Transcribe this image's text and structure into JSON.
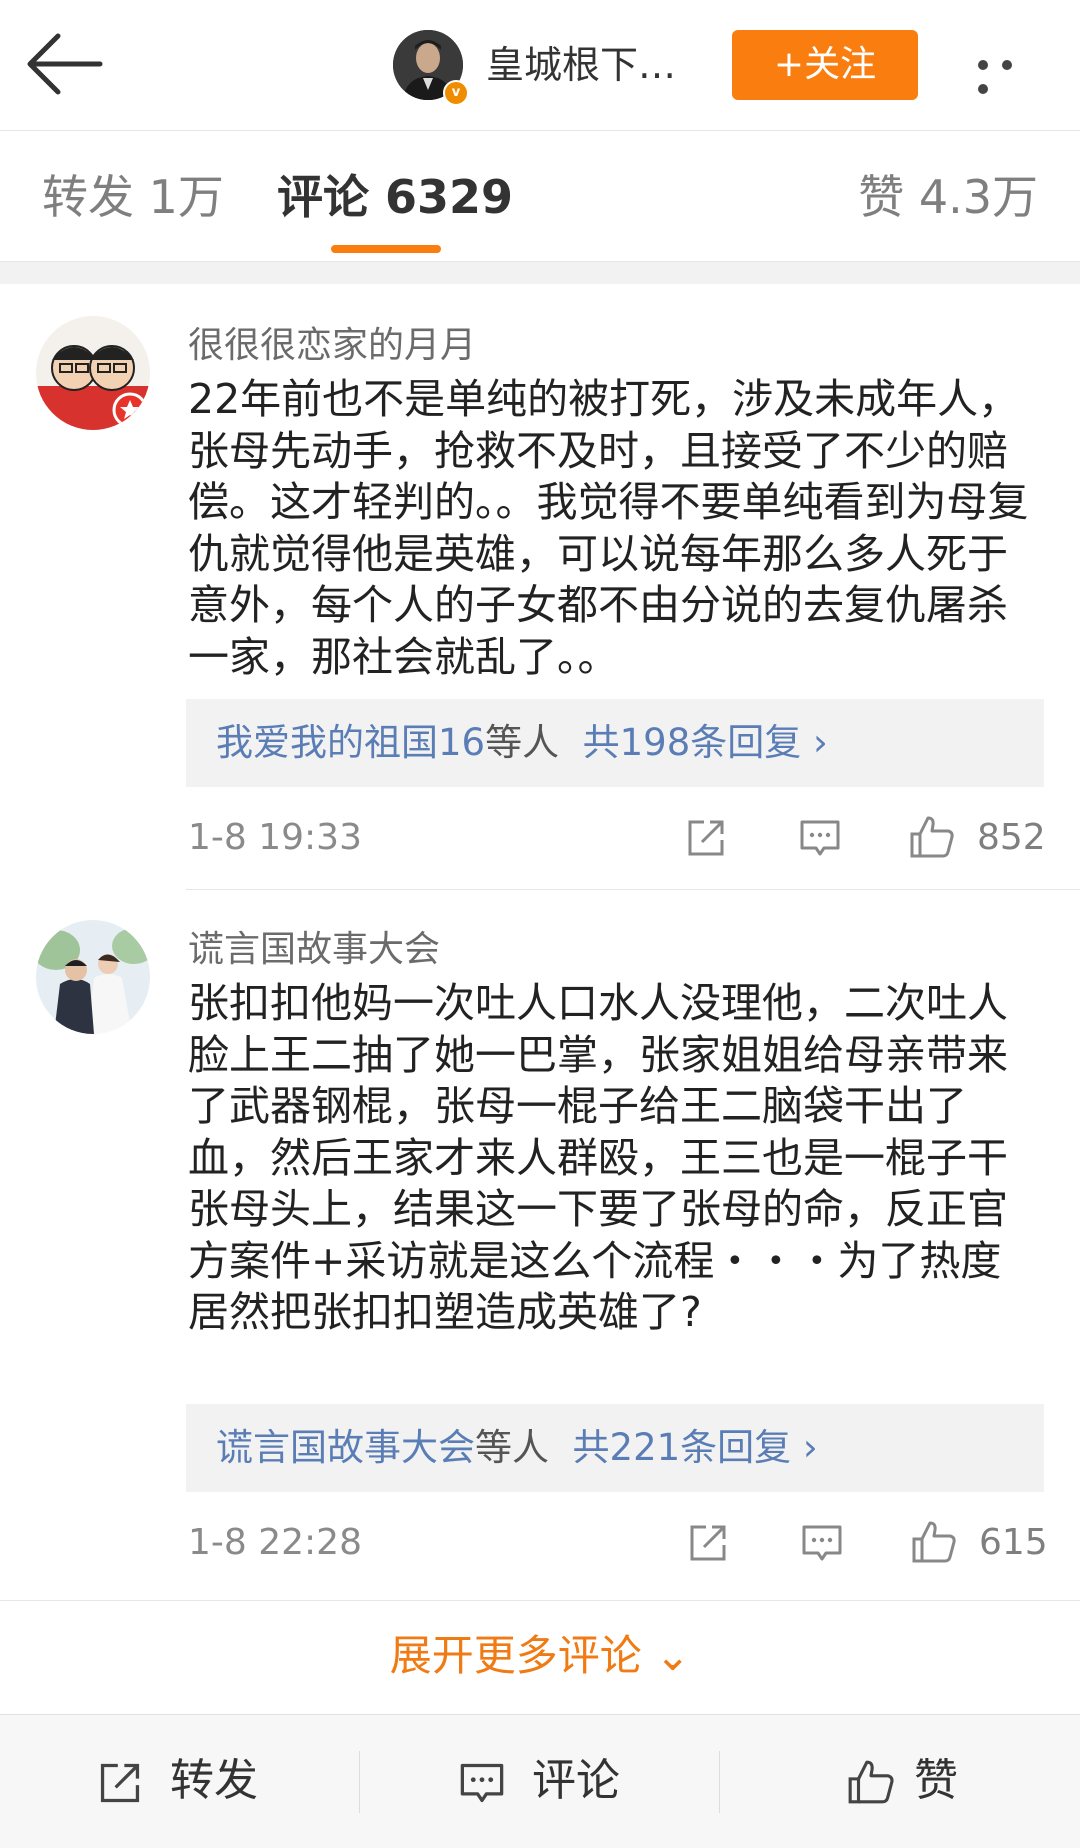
{
  "header": {
    "author_name": "皇城根下…",
    "follow_label": "+关注"
  },
  "tabs": {
    "repost": "转发 1万",
    "comment": "评论 6329",
    "like": "赞 4.3万"
  },
  "comments": [
    {
      "user": "很很很恋家的月月",
      "text": "22年前也不是单纯的被打死，涉及未成年人，张母先动手，抢救不及时，且接受了不少的赔偿。这才轻判的。。我觉得不要单纯看到为母复仇就觉得他是英雄，可以说每年那么多人死于意外，每个人的子女都不由分说的去复仇屠杀一家，那社会就乱了。。",
      "reply_users": "我爱我的祖国16",
      "reply_suffix": "等人",
      "reply_count": "共198条回复 ›",
      "time": "1-8 19:33",
      "likes": "852"
    },
    {
      "user": "谎言国故事大会",
      "text": "张扣扣他妈一次吐人口水人没理他，二次吐人脸上王二抽了她一巴掌，张家姐姐给母亲带来了武器钢棍，张母一棍子给王二脑袋干出了血，然后王家才来人群殴，王三也是一棍子干张母头上，结果这一下要了张母的命，反正官方案件+采访就是这么个流程・・・为了热度居然把张扣扣塑造成英雄了?",
      "reply_users": "谎言国故事大会",
      "reply_suffix": "等人",
      "reply_count": "共221条回复 ›",
      "time": "1-8 22:28",
      "likes": "615"
    }
  ],
  "expand_label": "展开更多评论 ⌄",
  "bottom_bar": {
    "repost": "转发",
    "comment": "评论",
    "like": "赞"
  },
  "colors": {
    "accent": "#fa7d0f",
    "link": "#5a7db5"
  }
}
